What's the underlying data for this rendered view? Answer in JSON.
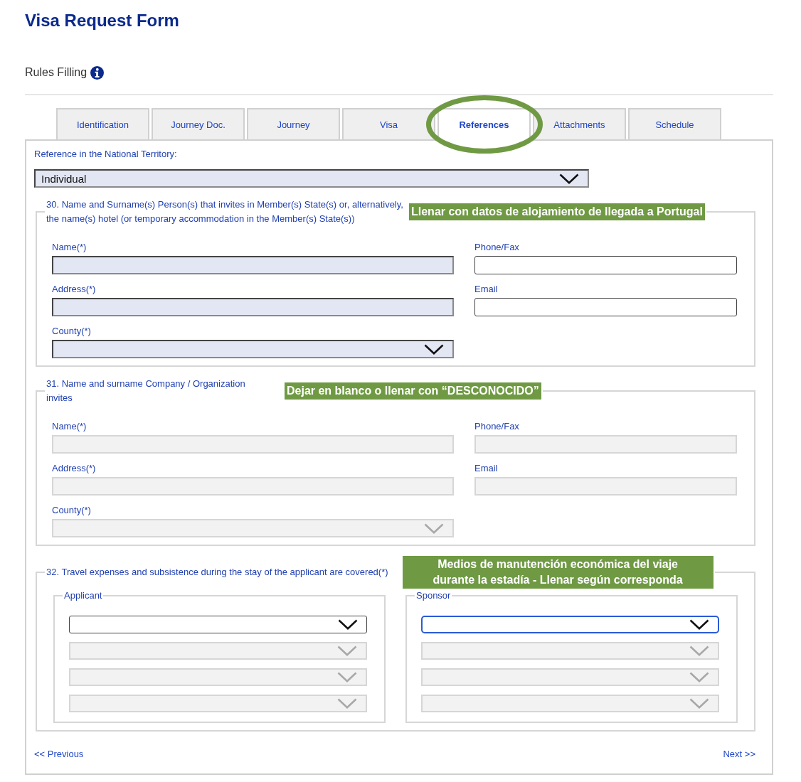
{
  "header": {
    "title": "Visa Request Form",
    "rules_label": "Rules Filling"
  },
  "tabs": [
    {
      "label": "Identification",
      "selected": false,
      "circled": false
    },
    {
      "label": "Journey Doc.",
      "selected": false,
      "circled": false
    },
    {
      "label": "Journey",
      "selected": false,
      "circled": false
    },
    {
      "label": "Visa",
      "selected": false,
      "circled": false
    },
    {
      "label": "References",
      "selected": true,
      "circled": true
    },
    {
      "label": "Attachments",
      "selected": false,
      "circled": false
    },
    {
      "label": "Schedule",
      "selected": false,
      "circled": false
    }
  ],
  "reference": {
    "label": "Reference in the National Territory:",
    "value": "Individual"
  },
  "sections": [
    {
      "kind": "fields",
      "legend": "30. Name and Surname(s) Person(s) that invites in Member(s) State(s) or, alternatively, the name(s) hotel (or temporary accommodation in the Member(s) State(s))",
      "note": "Llenar con datos de alojamiento de llegada a Portugal",
      "fields": [
        {
          "label": "Name(*)",
          "kind": "text",
          "required": true,
          "disabled": false
        },
        {
          "label": "Phone/Fax",
          "kind": "text",
          "required": false,
          "disabled": false
        },
        {
          "label": "Address(*)",
          "kind": "text",
          "required": true,
          "disabled": false
        },
        {
          "label": "Email",
          "kind": "text",
          "required": false,
          "disabled": false
        },
        {
          "label": "County(*)",
          "kind": "select",
          "required": true,
          "disabled": false
        }
      ]
    },
    {
      "kind": "fields",
      "legend": "31. Name and surname Company / Organization invites",
      "note": "Dejar en blanco o llenar con “DESCONOCIDO”",
      "fields": [
        {
          "label": "Name(*)",
          "kind": "text",
          "disabled": true
        },
        {
          "label": "Phone/Fax",
          "kind": "text",
          "disabled": true
        },
        {
          "label": "Address(*)",
          "kind": "text",
          "disabled": true
        },
        {
          "label": "Email",
          "kind": "text",
          "disabled": true
        },
        {
          "label": "County(*)",
          "kind": "select",
          "disabled": true
        }
      ]
    },
    {
      "kind": "groups",
      "legend": "32. Travel expenses and subsistence during the stay of the applicant are covered(*)",
      "note": "Medios de manutención económica del viaje durante la estadía - Llenar según corresponda",
      "groups": [
        {
          "legend": "Applicant",
          "selects": [
            {
              "disabled": false,
              "focused": false
            },
            {
              "disabled": true,
              "focused": false
            },
            {
              "disabled": true,
              "focused": false
            },
            {
              "disabled": true,
              "focused": false
            }
          ]
        },
        {
          "legend": "Sponsor",
          "selects": [
            {
              "disabled": false,
              "focused": true
            },
            {
              "disabled": true,
              "focused": false
            },
            {
              "disabled": true,
              "focused": false
            },
            {
              "disabled": true,
              "focused": false
            }
          ]
        }
      ]
    }
  ],
  "nav": {
    "previous": "<< Previous",
    "next": "Next >>"
  }
}
